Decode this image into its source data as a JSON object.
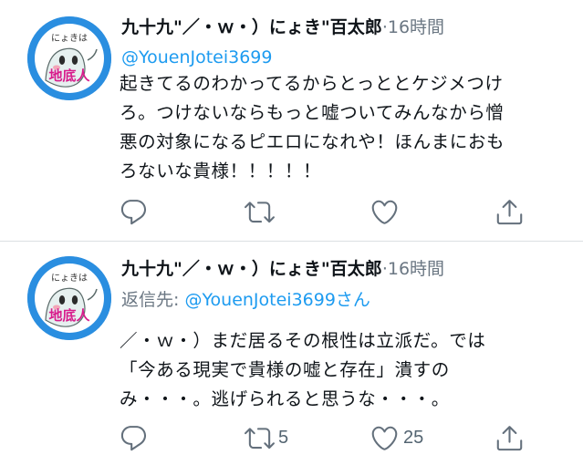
{
  "tweets": [
    {
      "avatar_text_top": "にょきは",
      "avatar_text_bottom": "地底人",
      "display_name": "九十九\"／・ｗ・）にょき\"百太郎",
      "separator": "·",
      "time": "16時間",
      "handle": "@YouenJotei3699",
      "body": "起きてるのわかってるからとっととケジメつけ\nろ。つけないならもっと嘘ついてみんなから憎\n悪の対象になるピエロになれや！ほんまにおも\nろないな貴様！！！！！",
      "actions": {
        "reply_count": "",
        "retweet_count": "",
        "like_count": ""
      }
    },
    {
      "avatar_text_top": "にょきは",
      "avatar_text_bottom": "地底人",
      "display_name": "九十九\"／・ｗ・）にょき\"百太郎",
      "separator": "·",
      "time": "16時間",
      "reply_prefix": "返信先: ",
      "reply_mention": "@YouenJotei3699さん",
      "body": "／・ｗ・）まだ居るその根性は立派だ。では\n「今ある現実で貴様の嘘と存在」潰すの\nみ・・・。逃げられると思うな・・・。",
      "actions": {
        "reply_count": "",
        "retweet_count": "5",
        "like_count": "25"
      }
    }
  ],
  "colors": {
    "link": "#1d9bf0",
    "muted": "#6b7783",
    "text": "#0f1419",
    "icon": "#64707c",
    "avatar_bg": "#2a8ee0"
  },
  "icons": [
    "reply-icon",
    "retweet-icon",
    "like-icon",
    "share-icon"
  ]
}
